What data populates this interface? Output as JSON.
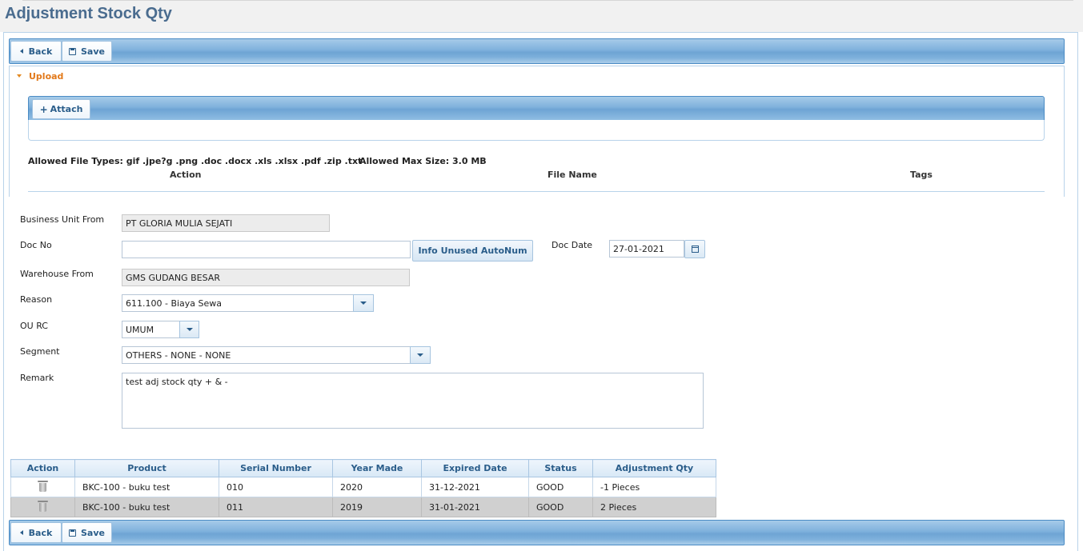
{
  "page": {
    "title": "Adjustment Stock Qty"
  },
  "toolbar": {
    "back_label": "Back",
    "save_label": "Save"
  },
  "upload": {
    "section_label": "Upload",
    "attach_label": "Attach",
    "allowed_types": "Allowed File Types: gif .jpe?g .png .doc .docx .xls .xlsx .pdf .zip .txt",
    "allowed_size": "Allowed Max Size: 3.0 MB",
    "columns": [
      "Action",
      "File Name",
      "Tags"
    ]
  },
  "form": {
    "business_unit_label": "Business Unit From",
    "business_unit_value": "PT GLORIA MULIA SEJATI",
    "doc_no_label": "Doc No",
    "doc_no_value": "",
    "info_button_label": "Info Unused AutoNum",
    "doc_date_label": "Doc Date",
    "doc_date_value": "27-01-2021",
    "warehouse_label": "Warehouse From",
    "warehouse_value": "GMS GUDANG BESAR",
    "reason_label": "Reason",
    "reason_value": "611.100 - Biaya Sewa",
    "ou_rc_label": "OU RC",
    "ou_rc_value": "UMUM",
    "segment_label": "Segment",
    "segment_value": "OTHERS - NONE - NONE",
    "remark_label": "Remark",
    "remark_value": "test adj stock qty + & -"
  },
  "grid": {
    "columns": [
      "Action",
      "Product",
      "Serial Number",
      "Year Made",
      "Expired Date",
      "Status",
      "Adjustment Qty"
    ],
    "rows": [
      {
        "product": "BKC-100 - buku test",
        "serial": "010",
        "year": "2020",
        "expired": "31-12-2021",
        "status": "GOOD",
        "qty": "-1 Pieces"
      },
      {
        "product": "BKC-100 - buku test",
        "serial": "011",
        "year": "2019",
        "expired": "31-01-2021",
        "status": "GOOD",
        "qty": "2 Pieces"
      }
    ]
  }
}
